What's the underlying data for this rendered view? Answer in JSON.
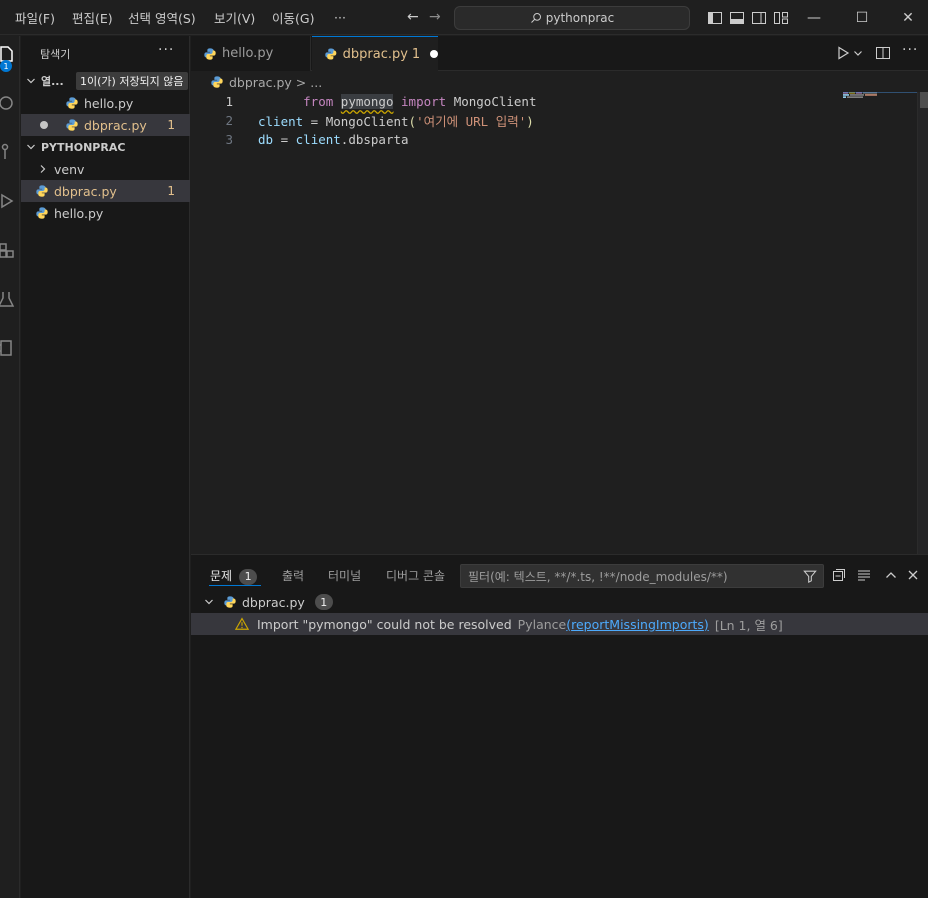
{
  "titlebar": {
    "menu": [
      "파일(F)",
      "편집(E)",
      "선택 영역(S)",
      "보기(V)",
      "이동(G)"
    ],
    "more": "···",
    "search_text": "pythonprac",
    "back_arrow": "←",
    "forward_arrow": "→",
    "window_buttons": [
      "—",
      "☐",
      "✕"
    ]
  },
  "activity": {
    "badge": "1"
  },
  "sidebar": {
    "title": "탐색기",
    "more": "···",
    "open_editors_label": "열...",
    "tooltip": "1이(가) 저장되지 않음",
    "open_editors": [
      {
        "name": "hello.py",
        "modified": false,
        "count": ""
      },
      {
        "name": "dbprac.py",
        "modified": true,
        "count": "1"
      }
    ],
    "folder_label": "PYTHONPRAC",
    "tree": [
      {
        "name": "venv",
        "type": "folder"
      },
      {
        "name": "dbprac.py",
        "count": "1",
        "modified": true
      },
      {
        "name": "hello.py",
        "count": "",
        "modified": false
      }
    ]
  },
  "tabs": [
    {
      "name": "hello.py",
      "active": false
    },
    {
      "name": "dbprac.py",
      "count": "1",
      "active": true,
      "dirty": true
    }
  ],
  "breadcrumb": {
    "file": "dbprac.py",
    "sep": ">",
    "more": "..."
  },
  "code": {
    "lines": [
      {
        "n": "1",
        "t1": "from",
        "t2": "pymongo",
        "t3": "import",
        "t4": "MongoClient"
      },
      {
        "n": "2",
        "t1": "client",
        "t2": " = ",
        "t3": "MongoClient",
        "t4": "(",
        "t5": "'여기에 URL 입력'",
        "t6": ")"
      },
      {
        "n": "3",
        "t1": "db",
        "t2": " = ",
        "t3": "client",
        "t4": ".dbsparta"
      }
    ]
  },
  "panel": {
    "tabs": [
      {
        "label": "문제",
        "badge": "1",
        "active": true
      },
      {
        "label": "출력"
      },
      {
        "label": "터미널"
      },
      {
        "label": "디버그 콘솔"
      }
    ],
    "filter_placeholder": "필터(예: 텍스트, **/*.ts, !**/node_modules/**)",
    "group": {
      "file": "dbprac.py",
      "count": "1"
    },
    "problem": {
      "message": "Import \"pymongo\" could not be resolved",
      "source": "Pylance",
      "code_link": "reportMissingImports",
      "location": "[Ln 1, 열 6]"
    }
  },
  "colors": {
    "accent": "#0078d4",
    "modified": "#e2c08d",
    "warning": "#cca700",
    "link": "#4daafc"
  }
}
